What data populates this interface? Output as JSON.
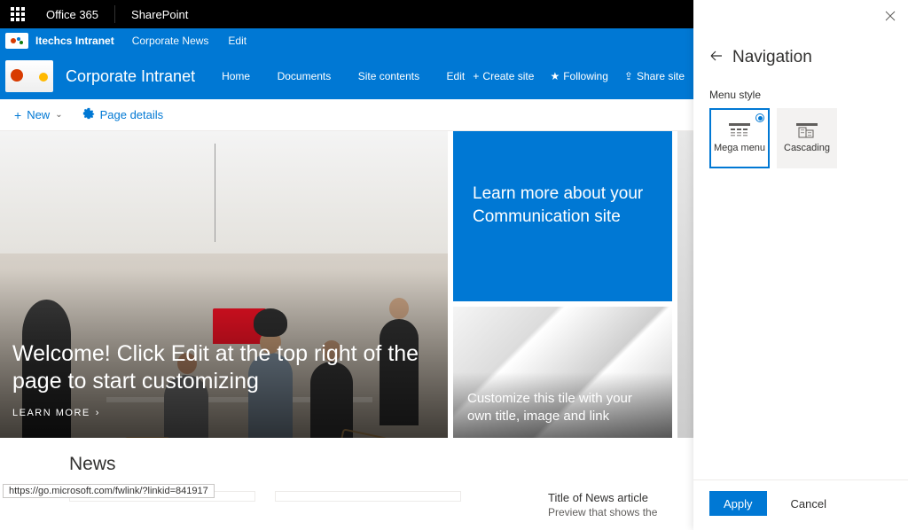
{
  "top_bar": {
    "office365": "Office 365",
    "sharepoint": "SharePoint"
  },
  "blue1": {
    "site": "Itechcs Intranet",
    "links": [
      "Corporate News",
      "Edit"
    ]
  },
  "blue2": {
    "site_title": "Corporate Intranet",
    "nav": [
      "Home",
      "Documents",
      "Site contents",
      "Edit"
    ],
    "create_site": "Create site",
    "following": "Following",
    "share_site": "Share site"
  },
  "command_bar": {
    "new": "New",
    "page_details": "Page details"
  },
  "hero": {
    "main_text": "Welcome! Click Edit at the top right of the page to start customizing",
    "learn_more": "LEARN MORE",
    "tile_top": "Learn more about your Communication site",
    "tile_bottom": "Customize this tile with your own title, image and link"
  },
  "news": {
    "heading": "News",
    "article_title": "Title of News article",
    "article_preview": "Preview that shows the"
  },
  "panel": {
    "title": "Navigation",
    "menu_style_label": "Menu style",
    "choice_mega": "Mega menu",
    "choice_cascading": "Cascading",
    "apply": "Apply",
    "cancel": "Cancel"
  },
  "status_url": "https://go.microsoft.com/fwlink/?linkid=841917"
}
